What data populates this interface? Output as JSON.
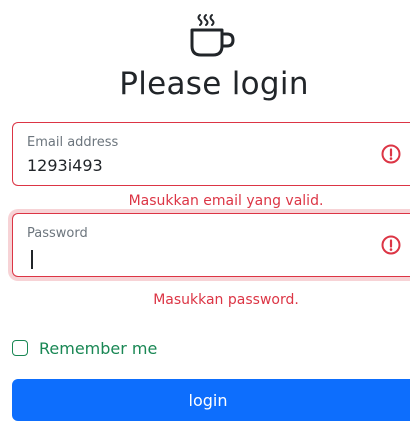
{
  "header": {
    "title": "Please login",
    "logo_icon": "coffee-cup-icon"
  },
  "form": {
    "email": {
      "label": "Email address",
      "value": "1293i493",
      "error": "Masukkan email yang valid.",
      "state": "invalid"
    },
    "password": {
      "label": "Password",
      "value": "",
      "error": "Masukkan password.",
      "state": "invalid-focused"
    },
    "remember_label": "Remember me",
    "remember_checked": false,
    "submit_label": "login"
  },
  "colors": {
    "danger": "#dc3545",
    "success": "#198754",
    "primary": "#0d6efd"
  }
}
